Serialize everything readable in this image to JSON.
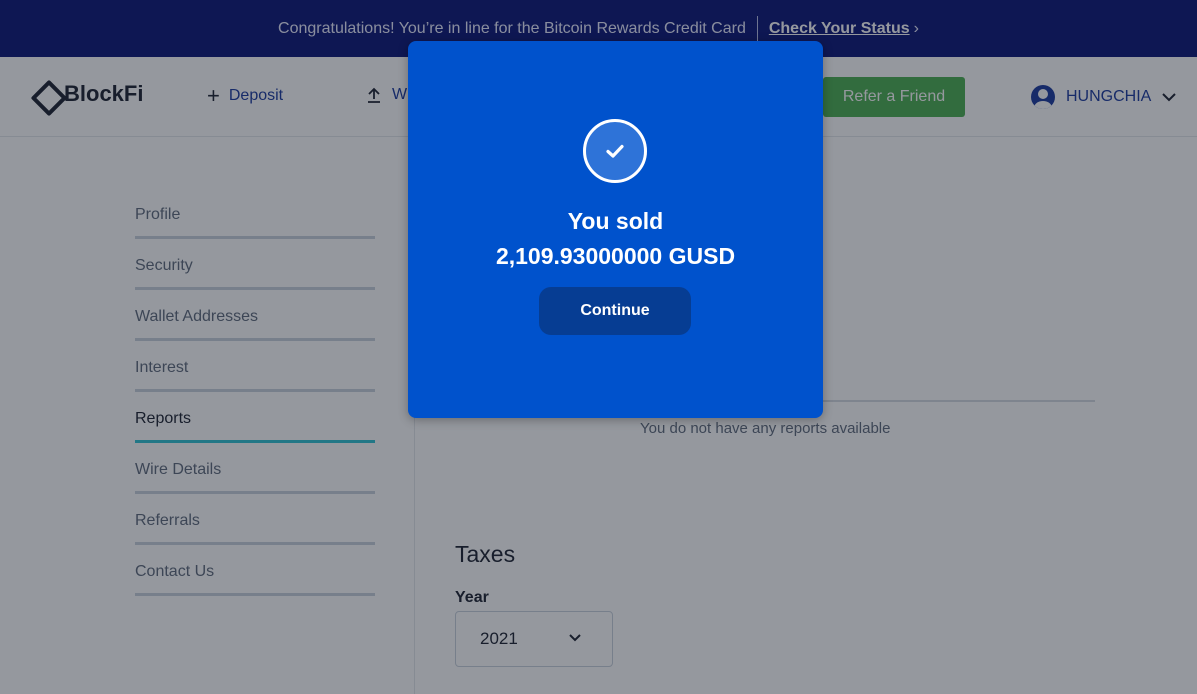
{
  "banner": {
    "message": "Congratulations! You’re in line for the Bitcoin Rewards Credit Card",
    "link_label": "Check Your Status",
    "arrow": "›"
  },
  "header": {
    "logo": "BlockFi",
    "nav": [
      {
        "label": "Deposit",
        "icon": "plus-icon"
      },
      {
        "label": "W",
        "icon": "upload-icon"
      }
    ],
    "refer_button": "Refer a Friend",
    "user_name": "HUNGCHIA"
  },
  "sidebar": {
    "items": [
      {
        "label": "Profile",
        "active": false
      },
      {
        "label": "Security",
        "active": false
      },
      {
        "label": "Wallet Addresses",
        "active": false
      },
      {
        "label": "Interest",
        "active": false
      },
      {
        "label": "Reports",
        "active": true
      },
      {
        "label": "Wire Details",
        "active": false
      },
      {
        "label": "Referrals",
        "active": false
      },
      {
        "label": "Contact Us",
        "active": false
      }
    ]
  },
  "main": {
    "no_reports": "You do not have any reports available",
    "taxes_title": "Taxes",
    "year_label": "Year",
    "year_value": "2021"
  },
  "modal": {
    "title": "You sold",
    "amount": "2,109.93000000 GUSD",
    "button": "Continue",
    "icon": "check-icon"
  },
  "colors": {
    "banner_bg": "#0a1477",
    "modal_bg": "#0052cc",
    "refer_bg": "#4caf50",
    "active_accent": "#2fc3d3",
    "link": "#1b3a9e"
  }
}
